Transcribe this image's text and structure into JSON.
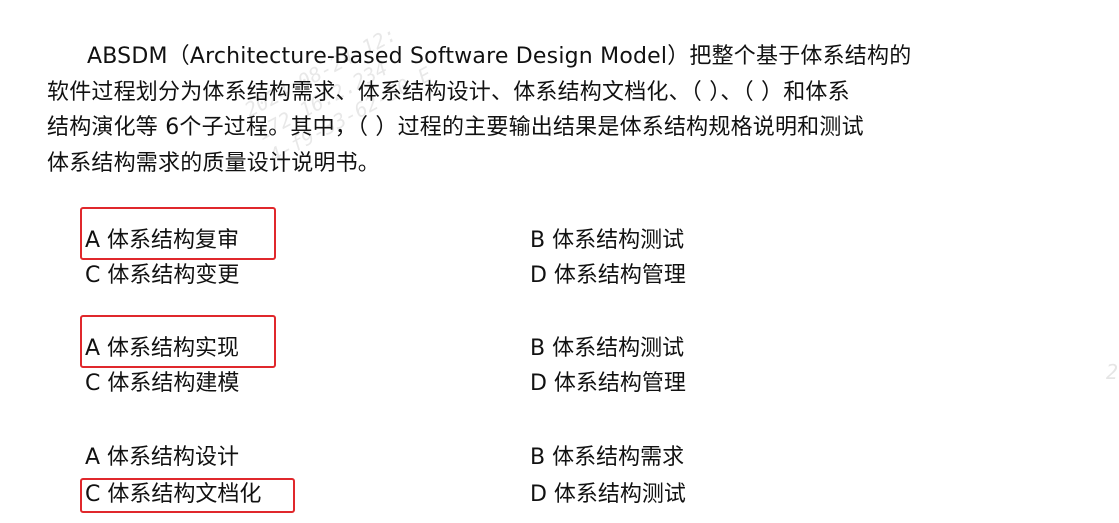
{
  "question": {
    "lines": [
      "ABSDM（Architecture-Based Software Design Model）把整个基于体系结构的",
      "软件过程划分为体系结构需求、体系结构设计、体系结构文档化、（ ）、（ ）和体系",
      "结构演化等 6个子过程。其中，（ ）过程的主要输出结果是体系结构规格说明和测试",
      "体系结构需求的质量设计说明书。"
    ]
  },
  "option_groups": [
    {
      "a": "A 体系结构复审",
      "b": "B 体系结构测试",
      "c": "C 体系结构变更",
      "d": "D 体系结构管理",
      "highlighted": "a"
    },
    {
      "a": "A 体系结构实现",
      "b": "B 体系结构测试",
      "c": "C 体系结构建模",
      "d": "D 体系结构管理",
      "highlighted": "a"
    },
    {
      "a": "A 体系结构设计",
      "b": "B 体系结构需求",
      "c": "C 体系结构文档化",
      "d": "D 体系结构测试",
      "highlighted": "c"
    }
  ],
  "watermark": {
    "lines": [
      "2024-08-24 12:",
      "172.16.2.234",
      "4-f9-33-62-50-E"
    ],
    "edge_char": "2"
  },
  "colors": {
    "highlight_border": "#e0282c",
    "text": "#111111"
  }
}
